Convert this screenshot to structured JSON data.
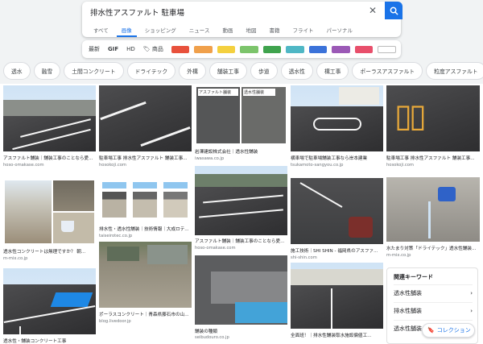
{
  "search": {
    "query": "排水性アスファルト 駐車場"
  },
  "tabs": [
    "すべて",
    "画像",
    "ショッピング",
    "ニュース",
    "動画",
    "地図",
    "書籍",
    "フライト",
    "パーソナル"
  ],
  "active_tab": "画像",
  "filters": {
    "latest": "最新",
    "gif": "GIF",
    "hd": "HD",
    "products": "商品"
  },
  "swatch_colors": [
    "#e8513c",
    "#f0a04b",
    "#f4d03f",
    "#7cc46b",
    "#3fa34d",
    "#4fb7c5",
    "#3b72d9",
    "#9b59b6",
    "#e84f6b",
    "#ffffff"
  ],
  "chips": [
    "透水",
    "融雪",
    "土間コンクリート",
    "ドライテック",
    "外構",
    "舗装工事",
    "歩道",
    "透水性",
    "構工事",
    "ポーラスアスファルト",
    "粒度アスファルト"
  ],
  "results": [
    {
      "caption": "アスファルト舗装｜舗装工事のことなら愛...",
      "source": "hoso-omakase.com"
    },
    {
      "caption": "駐車場工事 排水性アスファルト 舗装工事...",
      "source": "hosokoji.com"
    },
    {
      "caption": "岩澤建設株式会社｜透水性舗装",
      "source": "iwasawa.co.jp"
    },
    {
      "caption": "横車場で駐車場舗装工事なら岸本建業",
      "source": "tsukamoto-sangyou.co.jp"
    },
    {
      "caption": "駐車場工事 排水性アスファルト 舗装工事...",
      "source": "hosokoji.com"
    },
    {
      "caption": "透水性コンクリートは無理ですか？ 朝...",
      "source": "m-mix.co.jp"
    },
    {
      "caption": "排水性・透水性舗装｜技術情報｜大成ロテ...",
      "source": "taiseirotec.co.jp"
    },
    {
      "caption": "アスファルト舗装｜舗装工事のことなら愛...",
      "source": "hoso-omakase.com"
    },
    {
      "caption": "施工技術｜SHI SHIN - 福岡県のアスファ...",
      "source": "shi-shin.com"
    },
    {
      "caption": "水たまり対策「ドライテック」透水性舗装...",
      "source": "m-mix.co.jp"
    },
    {
      "caption": "ポーラスコンクリート｜青森県藤石市の山...",
      "source": "blog.livedoor.jp"
    },
    {
      "caption": "舗装の種類",
      "source": "seibudouro.co.jp"
    },
    {
      "caption": "全面班！｜排水性舗装取水施設偏値工...",
      "source": ""
    },
    {
      "caption": "透水性・舗装コンクリート工事",
      "source": ""
    }
  ],
  "overlays": {
    "asphalt_label": "アスファルト舗装",
    "permeable_label": "透水性舗装"
  },
  "related": {
    "title": "関連キーワード",
    "items": [
      "透水性舗装",
      "排水性舗装",
      "透水性舗装"
    ]
  },
  "collection_label": "コレクション"
}
